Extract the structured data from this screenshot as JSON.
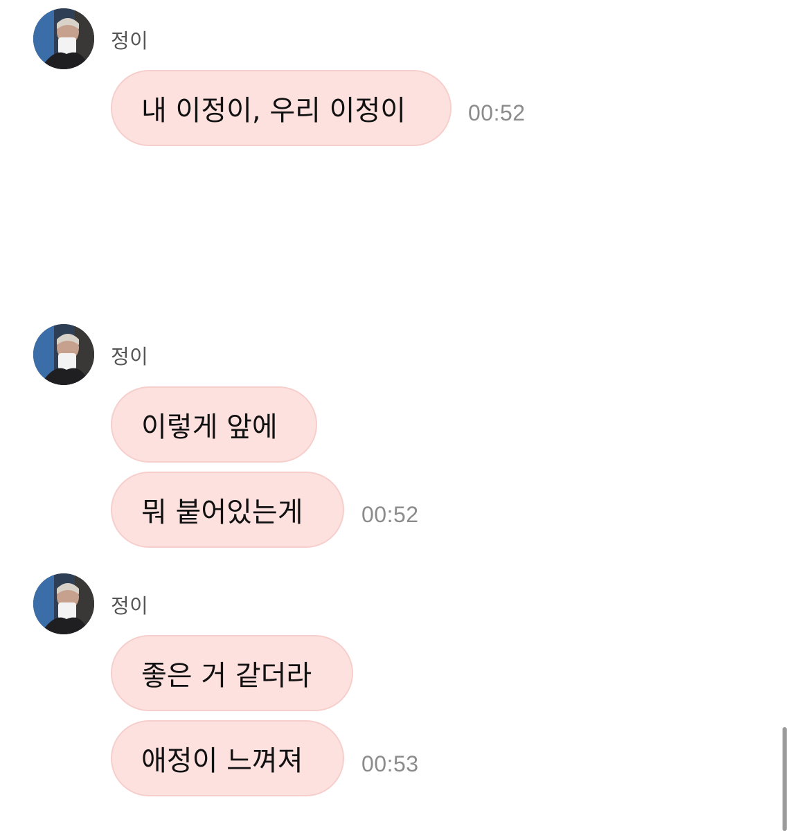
{
  "chat": {
    "groups": [
      {
        "sender": "정이",
        "messages": [
          "내 이정이, 우리 이정이"
        ],
        "time": "00:52"
      },
      {
        "sender": "정이",
        "messages": [
          "이렇게 앞에",
          "뭐 붙어있는게"
        ],
        "time": "00:52"
      },
      {
        "sender": "정이",
        "messages": [
          "좋은 거 같더라",
          "애정이 느껴져"
        ],
        "time": "00:53"
      }
    ]
  },
  "colors": {
    "bubble_bg": "#fde1df",
    "bubble_border": "#f6cfcc",
    "time_text": "#8b8b8b",
    "sender_text": "#555555"
  }
}
